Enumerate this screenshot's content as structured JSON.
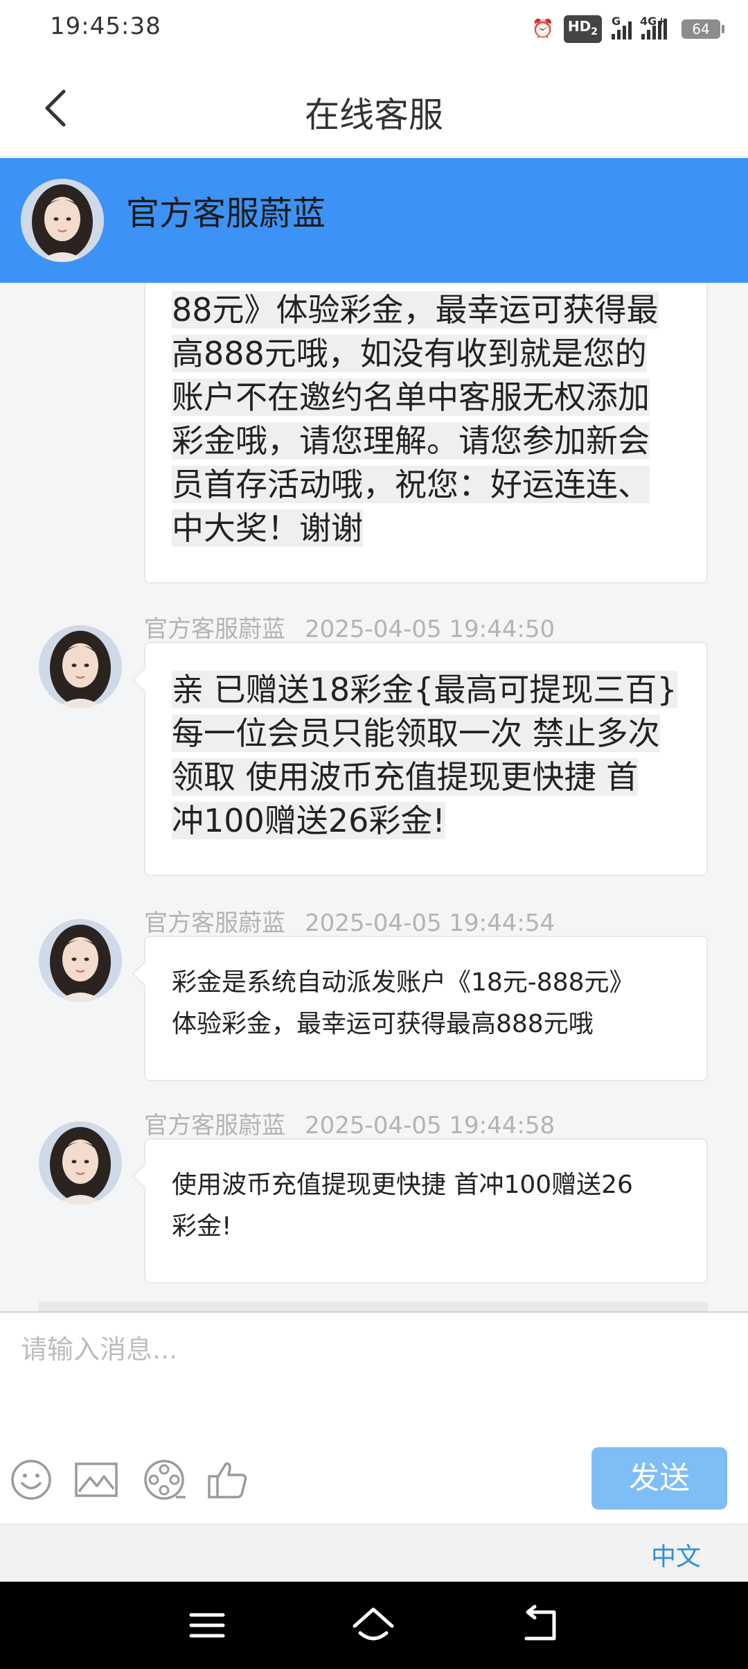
{
  "status_bar": {
    "time": "19:45:38",
    "hd_label": "HD",
    "hd_sub": "2",
    "network_1": "G",
    "network_2": "4G+",
    "battery": "64"
  },
  "header": {
    "title": "在线客服",
    "back_icon": "chevron-left-icon"
  },
  "agent": {
    "name": "官方客服蔚蓝"
  },
  "messages": [
    {
      "sender": "",
      "timestamp": "",
      "text": "88元》体验彩金，最幸运可获得最\n高888元哦，如没有收到就是您的\n账户不在邀约名单中客服无权添加\n彩金哦，请您理解。请您参加新会\n员首存活动哦，祝您：好运连连、\n中大奖！谢谢",
      "style": "large"
    },
    {
      "sender": "官方客服蔚蓝",
      "timestamp": "2025-04-05 19:44:50",
      "text": "亲 已赠送18彩金{最高可提现三百}\n每一位会员只能领取一次 禁止多次\n领取 使用波币充值提现更快捷 首\n冲100赠送26彩金!",
      "style": "large"
    },
    {
      "sender": "官方客服蔚蓝",
      "timestamp": "2025-04-05 19:44:54",
      "text": "彩金是系统自动派发账户《18元-888元》\n体验彩金，最幸运可获得最高888元哦",
      "style": "small"
    },
    {
      "sender": "官方客服蔚蓝",
      "timestamp": "2025-04-05 19:44:58",
      "text": "使用波币充值提现更快捷 首冲100赠送26\n彩金!",
      "style": "small"
    }
  ],
  "input": {
    "placeholder": "请输入消息...",
    "value": "",
    "send_label": "发送",
    "tools": [
      "emoji-icon",
      "image-icon",
      "film-reel-icon",
      "thumbs-up-icon"
    ]
  },
  "language": {
    "label": "中文"
  },
  "nav": {
    "icons": [
      "menu-icon",
      "home-icon",
      "back-arrow-icon"
    ]
  },
  "colors": {
    "agent_header_bg": "#3d92f5",
    "send_button_bg": "#7fbdf7",
    "language_link": "#2f8fd8",
    "chat_bg": "#f4f5f7"
  }
}
